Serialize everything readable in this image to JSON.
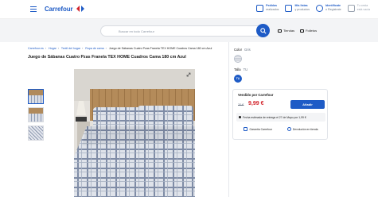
{
  "brand": {
    "name": "Carrefour",
    "accent": "#1e5bc6",
    "price_color": "#d3232a"
  },
  "header": {
    "utils": [
      {
        "top": "Pedidos",
        "bottom": "realizados",
        "icon": "box-icon"
      },
      {
        "top": "Mis listas",
        "bottom": "y productos",
        "icon": "list-icon"
      },
      {
        "top": "Identifícate",
        "bottom": "o Regístrate",
        "icon": "user-icon"
      },
      {
        "top": "Tu cesta",
        "bottom": "está vacía",
        "icon": "cart-icon"
      }
    ]
  },
  "search": {
    "placeholder": "Buscar en todo Carrefour",
    "links": [
      {
        "label": "Tiendas",
        "icon": "store-icon"
      },
      {
        "label": "Folletos",
        "icon": "flyer-icon"
      }
    ]
  },
  "breadcrumb": {
    "items": [
      "Carrefour.es",
      "Hogar",
      "Textil del hogar",
      "Ropa de cama"
    ],
    "current": "Juego de Sábanas Cuatro Pzas Franela TEX HOME Cuadros Cama 180 cm Azul"
  },
  "product": {
    "title": "Juego de Sábanas Cuatro Pzas Franela TEX HOME Cuadros Cama 180 cm Azul",
    "color_label": "Color",
    "color_value": "Gris",
    "size_label": "Talla",
    "size_value": "TU",
    "size_chip": "TU"
  },
  "buybox": {
    "sold_by": "Vendido por Carrefour",
    "old_price": "20 €",
    "price": "9,99 €",
    "add_label": "Añadir",
    "delivery": "Fecha estimada de entrega el 27 de Mayo por 1,99 €",
    "features": [
      {
        "label": "Garantía Carrefour",
        "icon": "shield-icon"
      },
      {
        "label": "Devolución en tienda",
        "icon": "return-icon"
      }
    ]
  }
}
